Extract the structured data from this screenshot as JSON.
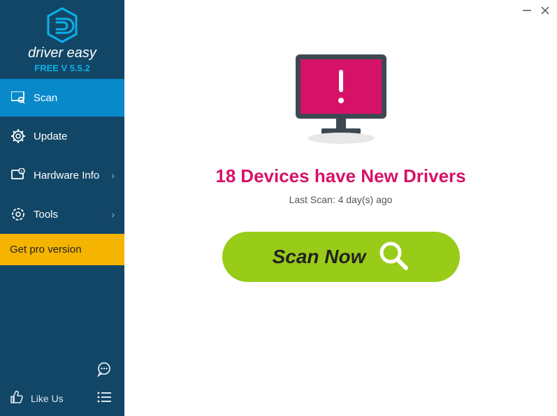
{
  "brand": {
    "name": "driver easy",
    "version": "FREE V 5.5.2"
  },
  "sidebar": {
    "items": [
      {
        "label": "Scan"
      },
      {
        "label": "Update"
      },
      {
        "label": "Hardware Info"
      },
      {
        "label": "Tools"
      }
    ],
    "get_pro": "Get pro version",
    "like_us": "Like Us"
  },
  "main": {
    "headline_count": "18",
    "headline_text": "Devices have New Drivers",
    "last_scan_label": "Last Scan:",
    "last_scan_value": "4 day(s) ago",
    "scan_button": "Scan Now"
  }
}
